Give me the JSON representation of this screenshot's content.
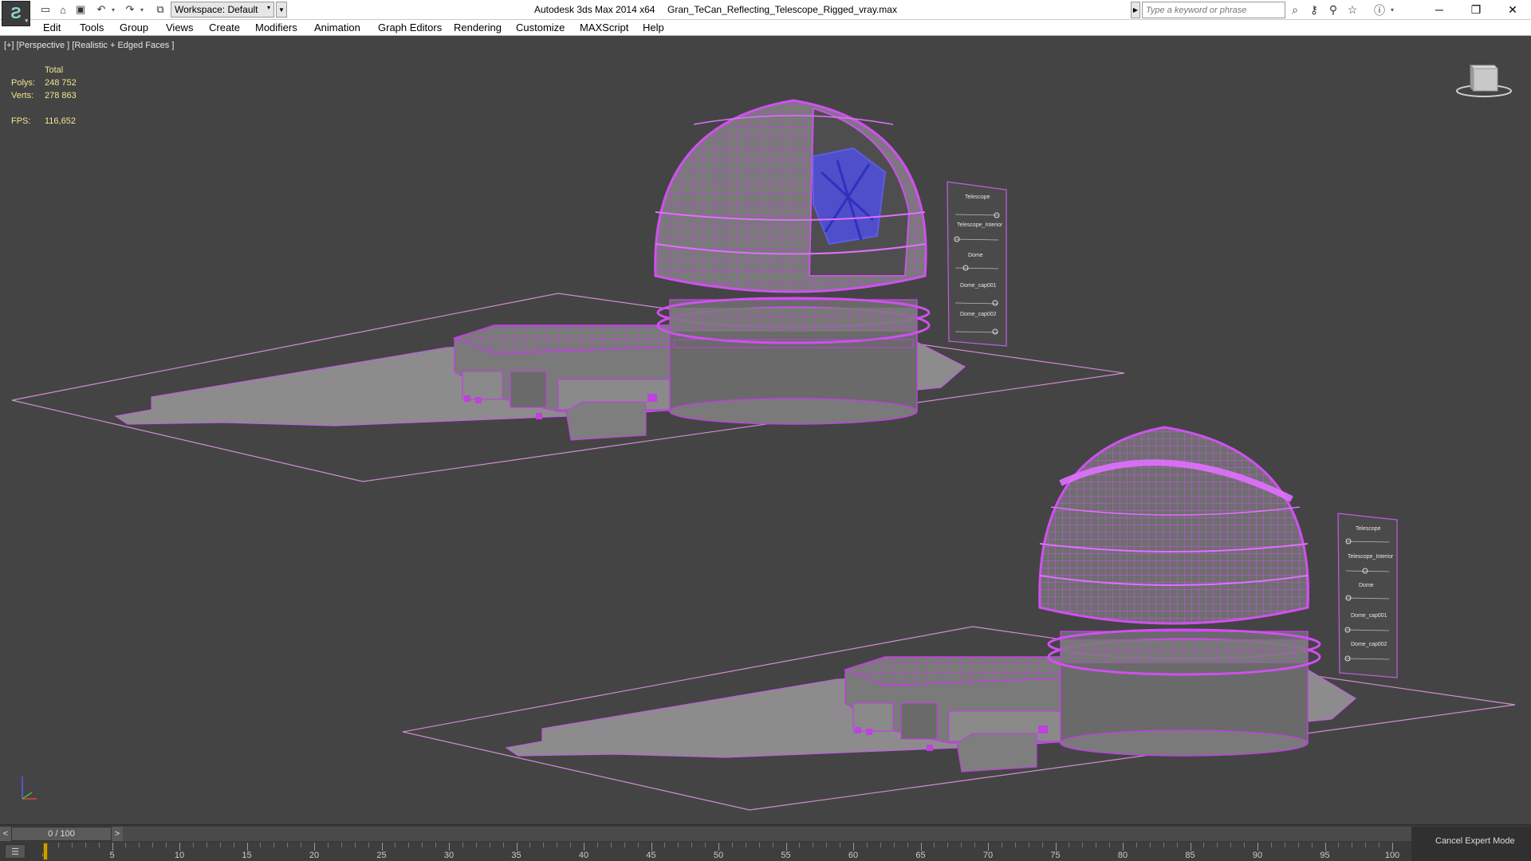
{
  "titlebar": {
    "workspace_label": "Workspace: Default",
    "app_title": "Autodesk 3ds Max  2014 x64",
    "file_title": "Gran_TeCan_Reflecting_Telescope_Rigged_vray.max",
    "search_placeholder": "Type a keyword or phrase",
    "icons": [
      "new-file-icon",
      "open-file-icon",
      "save-icon",
      "undo-icon",
      "redo-icon",
      "project-folder-icon",
      "binoculars-icon",
      "key-icon",
      "star-icon",
      "help-icon"
    ]
  },
  "menu": {
    "items": [
      "Edit",
      "Tools",
      "Group",
      "Views",
      "Create",
      "Modifiers",
      "Animation",
      "Graph Editors",
      "Rendering",
      "Customize",
      "MAXScript",
      "Help"
    ]
  },
  "viewport": {
    "label": "[+] [Perspective ] [Realistic + Edged Faces ]",
    "stats": {
      "total_label": "Total",
      "polys_label": "Polys:",
      "polys_value": "248 752",
      "verts_label": "Verts:",
      "verts_value": "278 863",
      "fps_label": "FPS:",
      "fps_value": "116,652"
    },
    "selection_sets_top": [
      "Telescope",
      "Telescope_Interior",
      "Dome",
      "Dome_cap001",
      "Dome_cap002"
    ],
    "selection_sets_bottom": [
      "Telescope",
      "Telescope_Interior",
      "Dome",
      "Dome_cap001",
      "Dome_cap002"
    ],
    "colors": {
      "wire": "#c040e0",
      "wire_light": "#e070ff",
      "telescope": "#5050e0",
      "ground": "#8a8a8a",
      "background": "#444444"
    }
  },
  "timeline": {
    "frame_display": "0 / 100",
    "prev_label": "<",
    "next_label": ">",
    "ticks": [
      "0",
      "5",
      "10",
      "15",
      "20",
      "25",
      "30",
      "35",
      "40",
      "45",
      "50",
      "55",
      "60",
      "65",
      "70",
      "75",
      "80",
      "85",
      "90",
      "95",
      "100"
    ],
    "cancel_expert_label": "Cancel Expert Mode"
  }
}
